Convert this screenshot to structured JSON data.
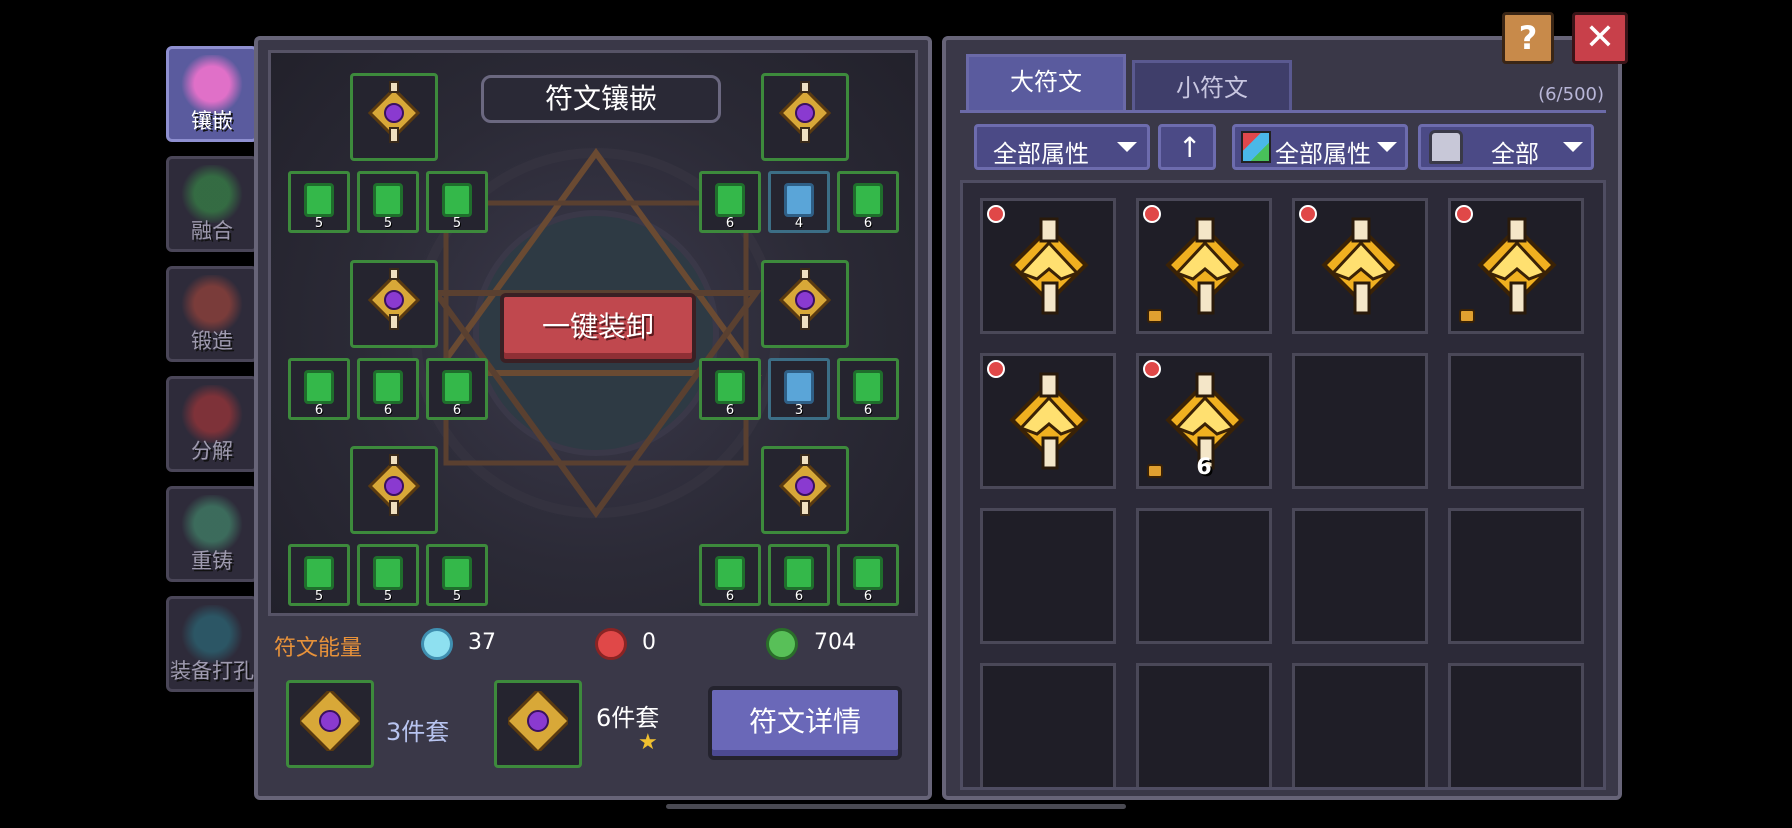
{
  "side_tabs": [
    {
      "label": "镶嵌",
      "active": true
    },
    {
      "label": "融合",
      "active": false
    },
    {
      "label": "锻造",
      "active": false
    },
    {
      "label": "分解",
      "active": false
    },
    {
      "label": "重铸",
      "active": false
    },
    {
      "label": "装备打孔",
      "active": false
    }
  ],
  "left_panel": {
    "title": "符文镶嵌",
    "unequip_all_label": "一键装卸",
    "left_groups": [
      {
        "small_slots": [
          {
            "level": "5"
          },
          {
            "level": "5"
          },
          {
            "level": "5"
          }
        ]
      },
      {
        "small_slots": [
          {
            "level": "6"
          },
          {
            "level": "6"
          },
          {
            "level": "6"
          }
        ]
      },
      {
        "small_slots": [
          {
            "level": "5"
          },
          {
            "level": "5"
          },
          {
            "level": "5"
          }
        ]
      }
    ],
    "right_groups": [
      {
        "small_slots": [
          {
            "level": "6"
          },
          {
            "level": "4",
            "color": "blue"
          },
          {
            "level": "6"
          }
        ]
      },
      {
        "small_slots": [
          {
            "level": "6"
          },
          {
            "level": "3",
            "color": "blue"
          },
          {
            "level": "6"
          }
        ]
      },
      {
        "small_slots": [
          {
            "level": "6"
          },
          {
            "level": "6"
          },
          {
            "level": "6"
          }
        ]
      }
    ],
    "energy_label": "符文能量",
    "energy": {
      "blue": "37",
      "red": "0",
      "green": "704"
    },
    "set_3_label": "3件套",
    "set_6_label": "6件套",
    "details_button": "符文详情"
  },
  "right_panel": {
    "tab_big": "大符文",
    "tab_small": "小符文",
    "count": "(6/500)",
    "filter_attr_1": "全部属性",
    "filter_attr_2": "全部属性",
    "filter_all": "全部",
    "items": [
      {
        "locked": false,
        "level": ""
      },
      {
        "locked": true,
        "level": ""
      },
      {
        "locked": false,
        "level": ""
      },
      {
        "locked": true,
        "level": ""
      },
      {
        "locked": false,
        "level": ""
      },
      {
        "locked": true,
        "level": "6"
      }
    ]
  },
  "colors": {
    "accent": "#5a5b9e",
    "slot_border_green": "#3d8a3c",
    "danger": "#c0484e",
    "energy_label": "#e8923a"
  },
  "top_buttons": {
    "help_icon": "question-icon",
    "close_icon": "close-icon"
  }
}
